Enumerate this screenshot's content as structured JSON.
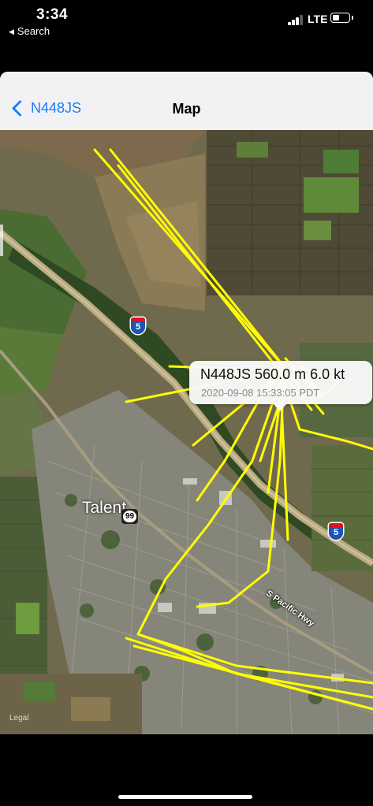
{
  "status_bar": {
    "time": "3:34",
    "back_app": "Search",
    "back_icon": "triangle-left-icon",
    "network": "LTE",
    "signal_bars": 3,
    "signal_bars_total": 4,
    "battery_level": 0.35
  },
  "navbar": {
    "back_label": "N448JS",
    "title": "Map"
  },
  "map": {
    "callout": {
      "line1": "N448JS  560.0 m 6.0 kt",
      "line2": "2020-09-08 15:33:05 PDT"
    },
    "places": {
      "town": "Talent",
      "road": "S Pacific Hwy"
    },
    "shields": {
      "interstate": "5",
      "state_route": "99"
    },
    "track_color": "#ffff00",
    "legal": "Legal"
  }
}
